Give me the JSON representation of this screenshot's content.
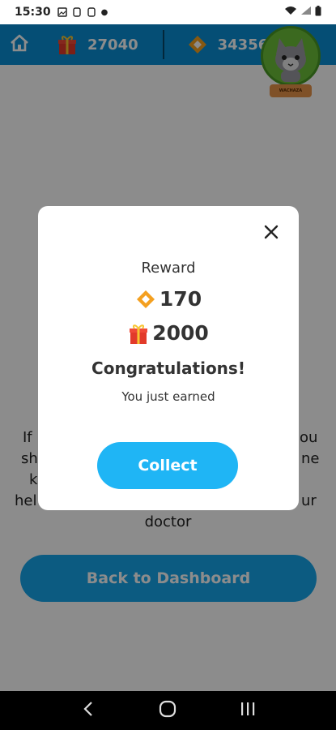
{
  "status_bar": {
    "time": "15:30"
  },
  "header": {
    "gifts_count": "27040",
    "gems_count": "34356",
    "profile_tag": "WACHAZA"
  },
  "background": {
    "text_lines": [
      {
        "left": "If",
        "right": "ou"
      },
      {
        "left": "sh",
        "right": "ne"
      },
      {
        "left": "k",
        "right": ""
      },
      {
        "left": "hel",
        "right": "ur"
      }
    ],
    "last_line": "doctor",
    "back_button": "Back to Dashboard"
  },
  "modal": {
    "title": "Reward",
    "gems_reward": "170",
    "gifts_reward": "2000",
    "congrats": "Congratulations!",
    "message": "You just earned",
    "collect_button": "Collect"
  },
  "colors": {
    "header_blue": "#0a8fd6",
    "button_blue": "#1fb5f5",
    "gem_orange": "#f4a020",
    "gift_red": "#e23a2a"
  }
}
